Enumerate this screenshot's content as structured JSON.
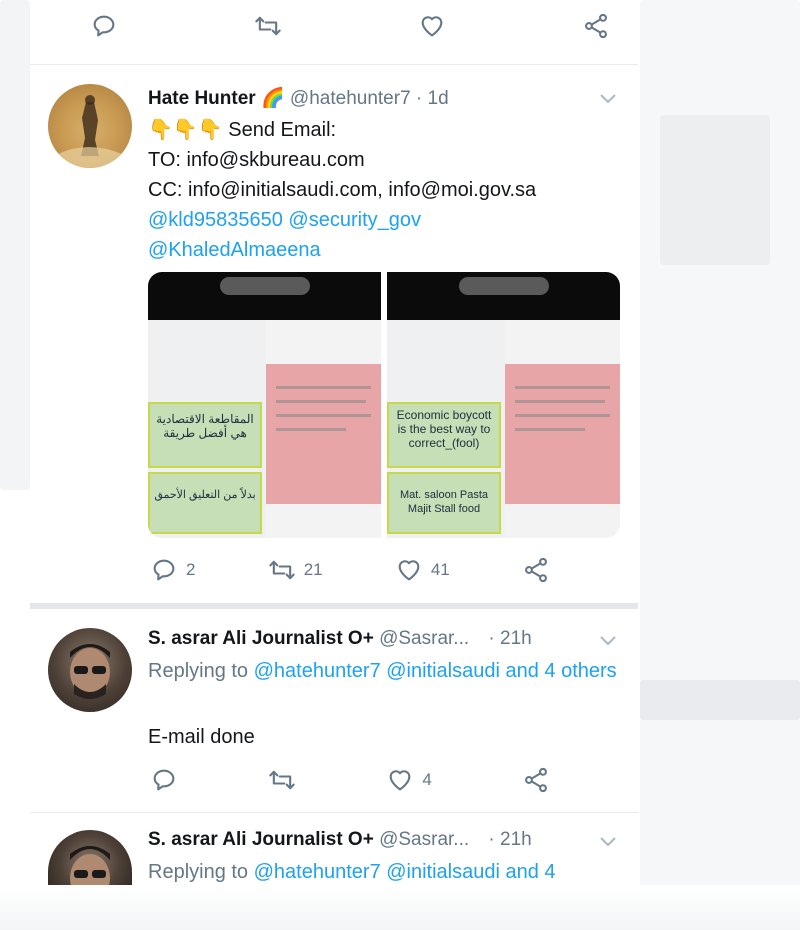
{
  "top_actions": {
    "reply_icon": "reply-icon",
    "retweet_icon": "retweet-icon",
    "like_icon": "heart-icon",
    "share_icon": "share-icon"
  },
  "tweet1": {
    "name": "Hate Hunter",
    "name_emoji": "🌈",
    "handle": "@hatehunter7",
    "time": "· 1d",
    "line1_emoji": "👇👇👇",
    "line1": "Send Email:",
    "line2": "TO: info@skbureau.com",
    "line3": "CC: info@initialsaudi.com, info@moi.gov.sa",
    "mention1": "@kld95835650",
    "mention2": "@security_gov",
    "mention3": "@KhaledAlmaeena",
    "media_left": {
      "green_text_1": "المقاطعة الاقتصادية هي أفضل طريقة",
      "green_text_2": "بدلاً من التعليق الأحمق"
    },
    "media_right": {
      "green_text_1": "Economic boycott is the best way to correct_(fool)",
      "green_text_2": "Mat. saloon Pasta Majit Stall food"
    },
    "replies": "2",
    "retweets": "21",
    "likes": "41"
  },
  "tweet2": {
    "name": "S. asrar Ali Journalist O+",
    "handle": "@Sasrar...",
    "time": "· 21h",
    "replying_prefix": "Replying to",
    "replying_to": "@hatehunter7 @initialsaudi and 4 others",
    "text": "E-mail done",
    "likes": "4"
  },
  "tweet3": {
    "name": "S. asrar Ali Journalist O+",
    "handle": "@Sasrar...",
    "time": "· 21h",
    "replying_prefix": "Replying to",
    "replying_to": "@hatehunter7 @initialsaudi and 4"
  }
}
